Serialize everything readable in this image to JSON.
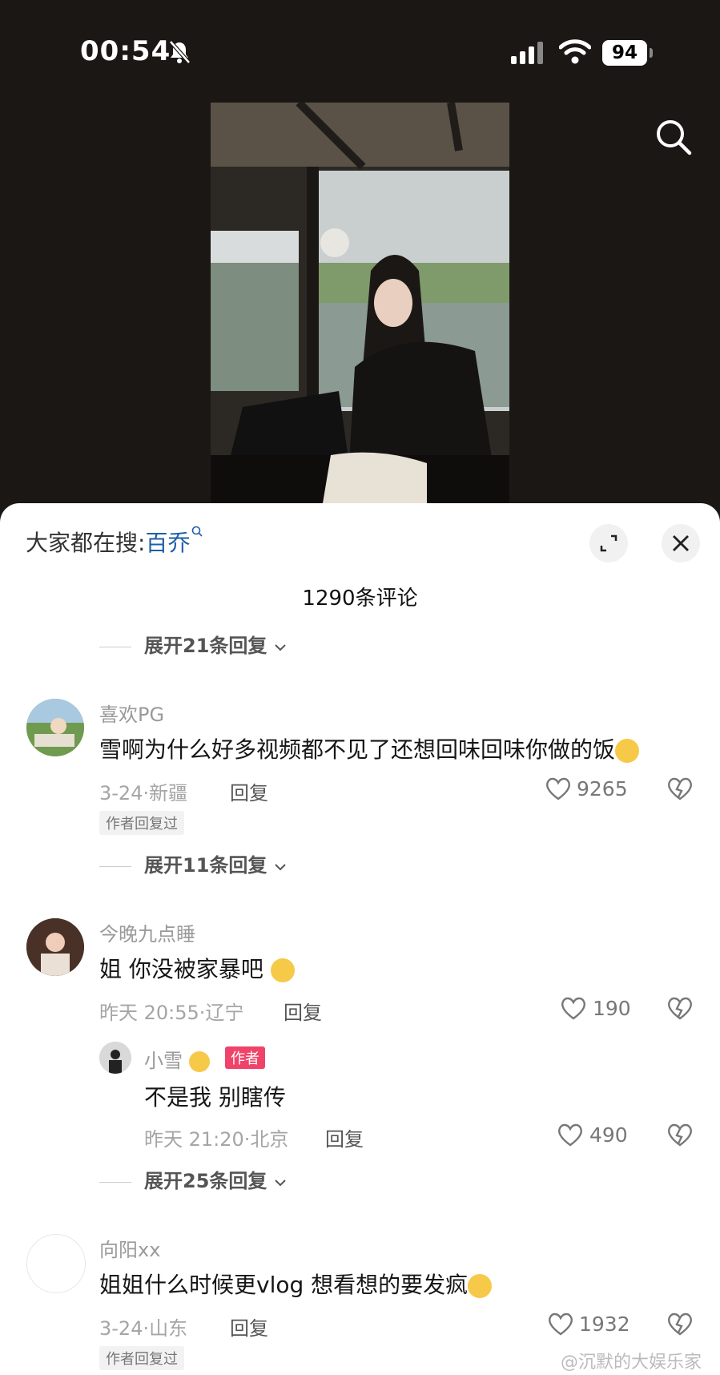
{
  "status": {
    "time": "00:54",
    "battery": "94"
  },
  "search_bar": {
    "label": "大家都在搜:",
    "keyword": "百乔"
  },
  "comments_count": "1290条评论",
  "expand_top": "展开21条回复",
  "comments": [
    {
      "user": "喜欢PG",
      "text": "雪啊为什么好多视频都不见了还想回味回味你做的饭",
      "date": "3-24·新疆",
      "reply": "回复",
      "likes": "9265",
      "tag": "作者回复过",
      "expand": "展开11条回复"
    },
    {
      "user": "今晚九点睡",
      "text": "姐 你没被家暴吧",
      "date": "昨天 20:55·辽宁",
      "reply": "回复",
      "likes": "190",
      "sub": {
        "user": "小雪",
        "author_tag": "作者",
        "text": "不是我 别瞎传",
        "date": "昨天 21:20·北京",
        "reply": "回复",
        "likes": "490"
      },
      "expand": "展开25条回复"
    },
    {
      "user": "向阳xx",
      "text": "姐姐什么时候更vlog 想看想的要发疯",
      "date": "3-24·山东",
      "reply": "回复",
      "likes": "1932",
      "tag": "作者回复过"
    }
  ],
  "watermark": "@沉默的大娱乐家",
  "icons": [
    "bell-muted-icon",
    "signal-icon",
    "wifi-icon",
    "search-icon",
    "expand-icon",
    "close-icon",
    "heart-icon",
    "dislike-icon",
    "chevron-down-icon"
  ]
}
